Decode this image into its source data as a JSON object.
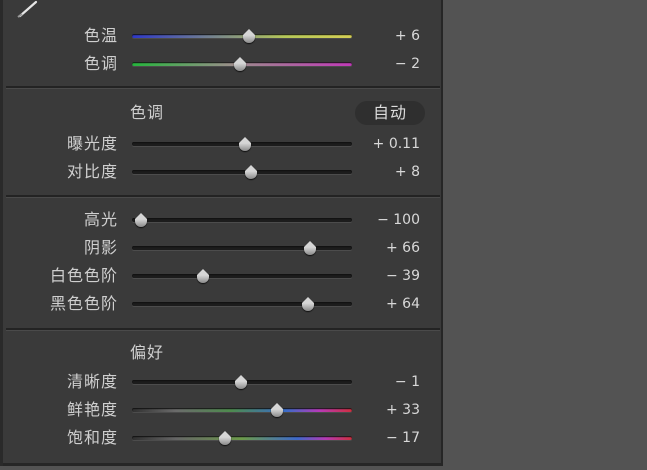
{
  "white_balance": {
    "sliders": [
      {
        "label": "色温",
        "value": "+ 6",
        "position": 0.53,
        "style": "temp"
      },
      {
        "label": "色调",
        "value": "− 2",
        "position": 0.49,
        "style": "tint"
      }
    ]
  },
  "tone": {
    "title": "色调",
    "auto_label": "自动",
    "sliders": [
      {
        "label": "曝光度",
        "value": "+ 0.11",
        "position": 0.51,
        "style": "plain"
      },
      {
        "label": "对比度",
        "value": "+ 8",
        "position": 0.54,
        "style": "plain"
      }
    ]
  },
  "tone_detail": {
    "sliders": [
      {
        "label": "高光",
        "value": "− 100",
        "position": 0.0,
        "style": "plain"
      },
      {
        "label": "阴影",
        "value": "+ 66",
        "position": 0.83,
        "style": "plain"
      },
      {
        "label": "白色色阶",
        "value": "− 39",
        "position": 0.31,
        "style": "plain"
      },
      {
        "label": "黑色色阶",
        "value": "+ 64",
        "position": 0.82,
        "style": "plain"
      }
    ]
  },
  "presence": {
    "title": "偏好",
    "sliders": [
      {
        "label": "清晰度",
        "value": "− 1",
        "position": 0.5,
        "style": "plain"
      },
      {
        "label": "鲜艳度",
        "value": "+ 33",
        "position": 0.66,
        "style": "vib"
      },
      {
        "label": "饱和度",
        "value": "− 17",
        "position": 0.42,
        "style": "sat"
      }
    ]
  }
}
